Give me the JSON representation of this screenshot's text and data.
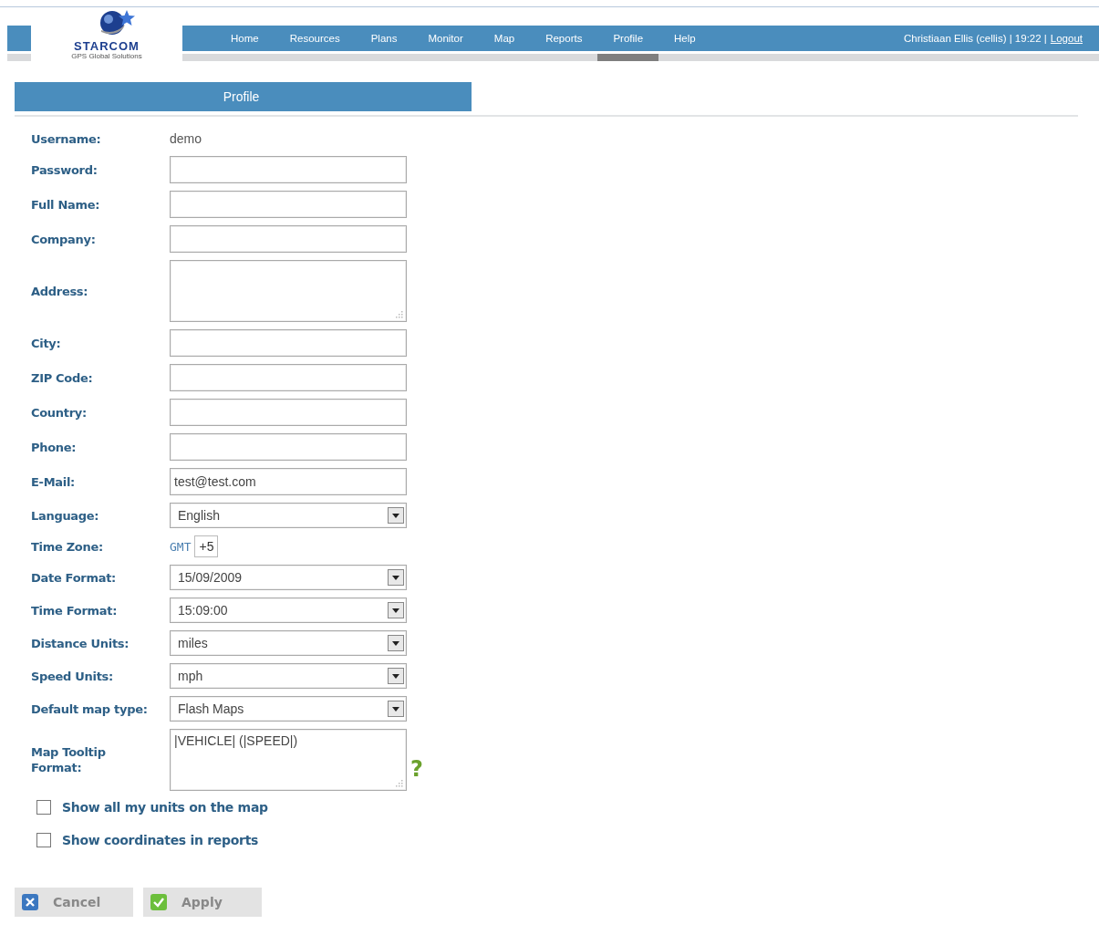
{
  "logo": {
    "name": "STARCOM",
    "tagline": "GPS Global Solutions"
  },
  "nav": [
    {
      "label": "Home",
      "selected": false
    },
    {
      "label": "Resources",
      "selected": false
    },
    {
      "label": "Plans",
      "selected": false
    },
    {
      "label": "Monitor",
      "selected": false
    },
    {
      "label": "Map",
      "selected": false
    },
    {
      "label": "Reports",
      "selected": false
    },
    {
      "label": "Profile",
      "selected": true
    },
    {
      "label": "Help",
      "selected": false
    }
  ],
  "user_info": {
    "text": "Christiaan Ellis (cellis) | 19:22 |",
    "logout": "Logout"
  },
  "panel_title": "Profile",
  "fields": [
    {
      "kind": "static",
      "label": "Username:",
      "value": "demo"
    },
    {
      "kind": "text",
      "label": "Password:"
    },
    {
      "kind": "text",
      "label": "Full Name:"
    },
    {
      "kind": "text",
      "label": "Company:"
    },
    {
      "kind": "textarea",
      "label": "Address:"
    },
    {
      "kind": "text",
      "label": "City:"
    },
    {
      "kind": "text",
      "label": "ZIP Code:"
    },
    {
      "kind": "text",
      "label": "Country:"
    },
    {
      "kind": "text",
      "label": "Phone:"
    },
    {
      "kind": "text",
      "label": "E-Mail:",
      "value": "test@test.com"
    },
    {
      "kind": "select",
      "label": "Language:",
      "value": "English"
    },
    {
      "kind": "timezone",
      "label": "Time Zone:",
      "prefix": "GMT",
      "value": "+5"
    },
    {
      "kind": "select",
      "label": "Date Format:",
      "value": "15/09/2009"
    },
    {
      "kind": "select",
      "label": "Time Format:",
      "value": "15:09:00"
    },
    {
      "kind": "select",
      "label": "Distance Units:",
      "value": "miles"
    },
    {
      "kind": "select",
      "label": "Speed Units:",
      "value": "mph"
    },
    {
      "kind": "select",
      "label": "Default map type:",
      "value": "Flash Maps"
    },
    {
      "kind": "textarea",
      "label": "Map Tooltip Format:",
      "value": "|VEHICLE| (|SPEED|)",
      "help": "?"
    }
  ],
  "options": [
    {
      "label": "Show all my units on the map",
      "checked": false
    },
    {
      "label": "Show coordinates in reports",
      "checked": false
    }
  ],
  "buttons": [
    {
      "kind": "cancel",
      "label": "Cancel"
    },
    {
      "kind": "apply",
      "label": "Apply"
    }
  ]
}
